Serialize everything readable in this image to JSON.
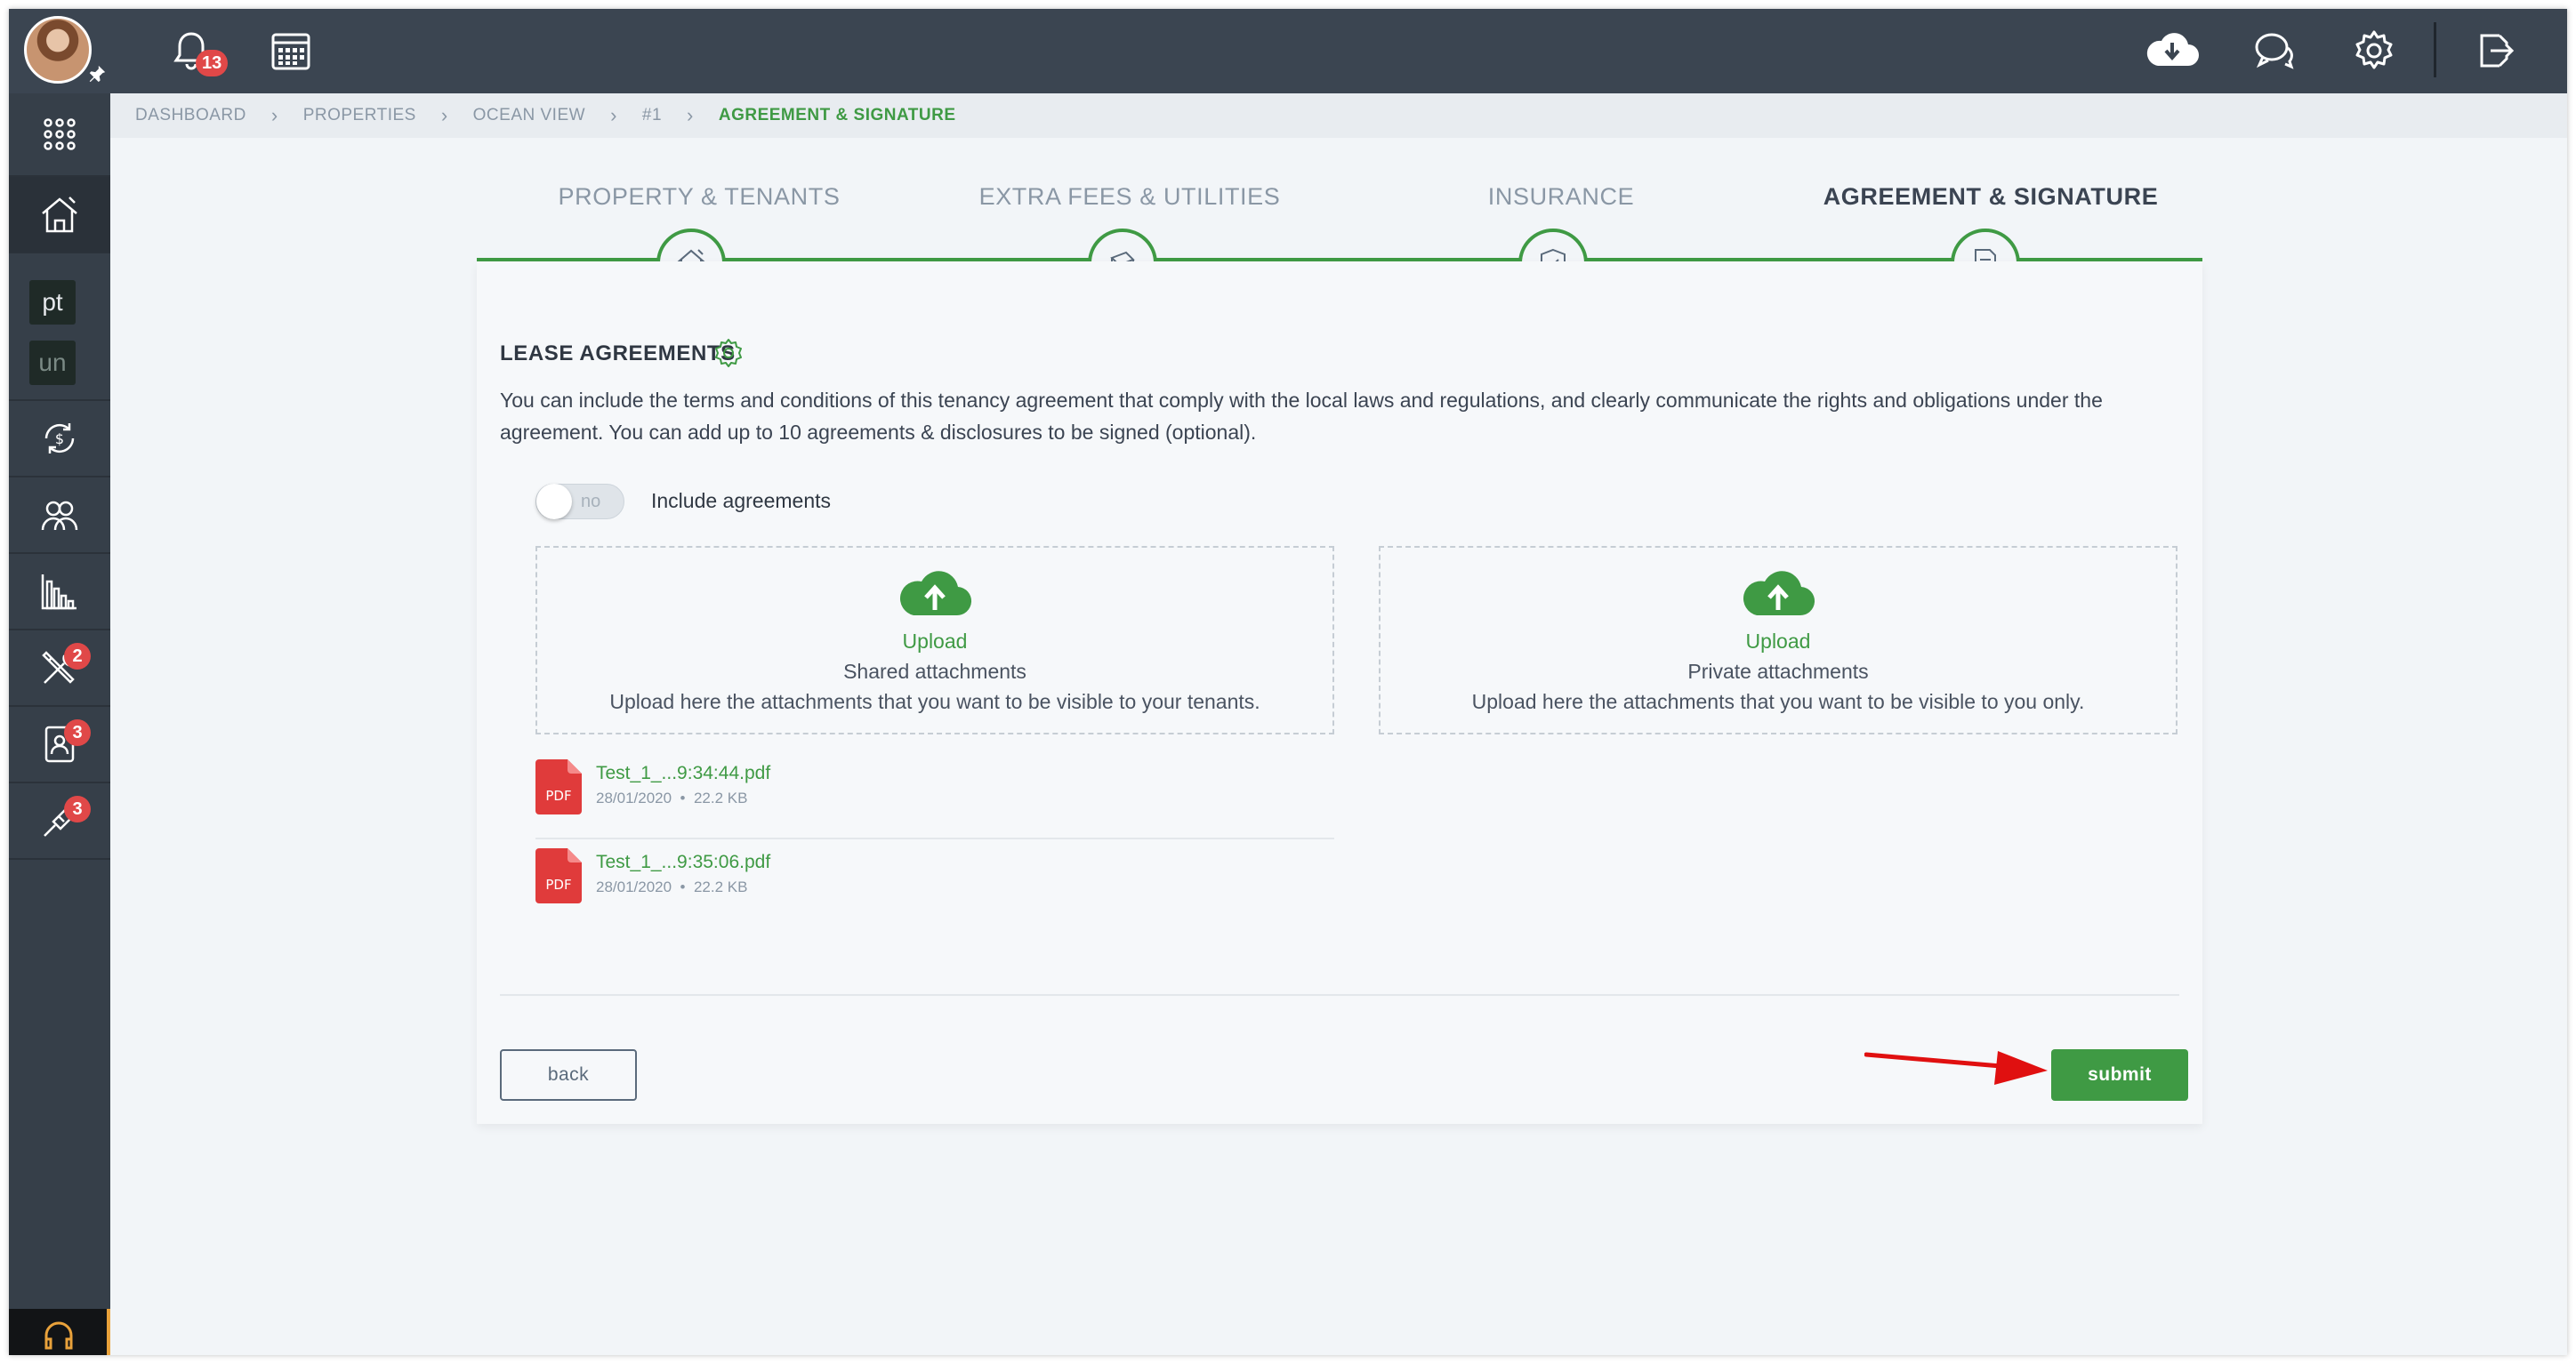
{
  "topbar": {
    "notifications_count": "13",
    "icons": [
      "bell-icon",
      "calendar-icon",
      "cloud-download-icon",
      "chat-icon",
      "gear-icon",
      "logout-icon"
    ]
  },
  "sidebar": {
    "tags": [
      "pt",
      "un"
    ],
    "badges": {
      "maintenance": "2",
      "tenant_requests": "3",
      "tools": "3"
    }
  },
  "breadcrumb": {
    "items": [
      "DASHBOARD",
      "PROPERTIES",
      "OCEAN VIEW",
      "#1"
    ],
    "current": "AGREEMENT & SIGNATURE"
  },
  "steps": [
    {
      "label": "PROPERTY & TENANTS",
      "icon": "house-icon"
    },
    {
      "label": "EXTRA FEES & UTILITIES",
      "icon": "money-stack-icon"
    },
    {
      "label": "INSURANCE",
      "icon": "shield-icon"
    },
    {
      "label": "AGREEMENT & SIGNATURE",
      "icon": "document-sign-icon"
    }
  ],
  "lease": {
    "title": "LEASE AGREEMENTS",
    "description": "You can include the terms and conditions of this tenancy agreement that comply with the local laws and regulations, and clearly communicate the rights and obligations under the agreement. You can add up to 10 agreements & disclosures to be signed (optional).",
    "toggle_state": "no",
    "toggle_label": "Include agreements"
  },
  "uploads": {
    "shared": {
      "action": "Upload",
      "title": "Shared attachments",
      "description": "Upload here the attachments that you want to be visible to your tenants."
    },
    "private": {
      "action": "Upload",
      "title": "Private attachments",
      "description": "Upload here the attachments that you want to be visible to you only."
    }
  },
  "files": [
    {
      "name": "Test_1_...9:34:44.pdf",
      "date": "28/01/2020",
      "size": "22.2 KB",
      "type": "PDF"
    },
    {
      "name": "Test_1_...9:35:06.pdf",
      "date": "28/01/2020",
      "size": "22.2 KB",
      "type": "PDF"
    }
  ],
  "actions": {
    "back": "back",
    "submit": "submit"
  },
  "colors": {
    "accent": "#3f9a44",
    "topbar": "#3b4551",
    "sidebar": "#363f49",
    "badge": "#e04848",
    "pdf": "#e03b3b",
    "annotation_arrow": "#e01010"
  }
}
